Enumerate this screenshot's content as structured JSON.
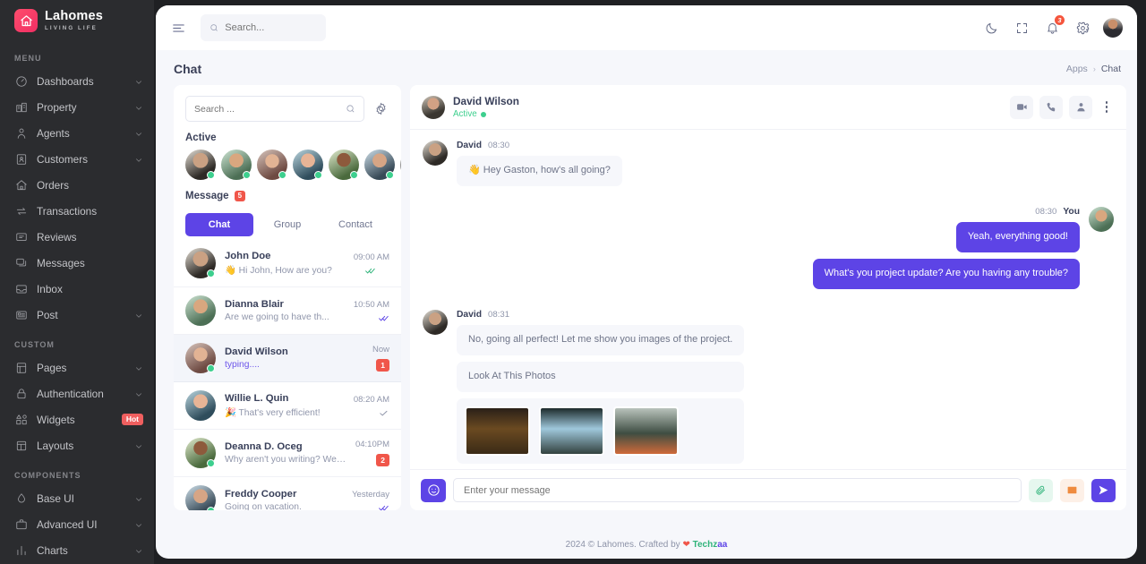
{
  "brand": {
    "name": "Lahomes",
    "tagline": "LIVING LIFE",
    "accent": "#5d44e6",
    "logo_color": "#f02e63"
  },
  "sidebar": {
    "sections": [
      {
        "label": "MENU",
        "items": [
          {
            "label": "Dashboards",
            "icon": "dashboard-icon",
            "chevron": true
          },
          {
            "label": "Property",
            "icon": "property-icon",
            "chevron": true
          },
          {
            "label": "Agents",
            "icon": "agents-icon",
            "chevron": true
          },
          {
            "label": "Customers",
            "icon": "customers-icon",
            "chevron": true
          },
          {
            "label": "Orders",
            "icon": "orders-icon",
            "chevron": false
          },
          {
            "label": "Transactions",
            "icon": "transactions-icon",
            "chevron": false
          },
          {
            "label": "Reviews",
            "icon": "reviews-icon",
            "chevron": false
          },
          {
            "label": "Messages",
            "icon": "messages-icon",
            "chevron": false
          },
          {
            "label": "Inbox",
            "icon": "inbox-icon",
            "chevron": false
          },
          {
            "label": "Post",
            "icon": "post-icon",
            "chevron": true
          }
        ]
      },
      {
        "label": "CUSTOM",
        "items": [
          {
            "label": "Pages",
            "icon": "pages-icon",
            "chevron": true
          },
          {
            "label": "Authentication",
            "icon": "lock-icon",
            "chevron": true
          },
          {
            "label": "Widgets",
            "icon": "widgets-icon",
            "chevron": false,
            "badge": "Hot"
          },
          {
            "label": "Layouts",
            "icon": "layouts-icon",
            "chevron": true
          }
        ]
      },
      {
        "label": "COMPONENTS",
        "items": [
          {
            "label": "Base UI",
            "icon": "baseui-icon",
            "chevron": true
          },
          {
            "label": "Advanced UI",
            "icon": "advancedui-icon",
            "chevron": true
          },
          {
            "label": "Charts",
            "icon": "charts-icon",
            "chevron": true
          }
        ]
      }
    ]
  },
  "topbar": {
    "search_placeholder": "Search...",
    "notification_count": "3"
  },
  "page": {
    "title": "Chat",
    "breadcrumb_root": "Apps",
    "breadcrumb_sep": "›",
    "breadcrumb_current": "Chat"
  },
  "chat_list": {
    "search_placeholder": "Search ...",
    "active_label": "Active",
    "active_count": 6,
    "message_label": "Message",
    "message_badge": "5",
    "tabs": [
      {
        "label": "Chat",
        "active": true
      },
      {
        "label": "Group",
        "active": false
      },
      {
        "label": "Contact",
        "active": false
      }
    ],
    "rows": [
      {
        "name": "John Doe",
        "preview": "👋 Hi John, How are you?",
        "time": "09:00 AM",
        "online": true,
        "status": "read-pin",
        "selected": false
      },
      {
        "name": "Dianna Blair",
        "preview": "Are we going to have th...",
        "time": "10:50 AM",
        "online": false,
        "status": "read",
        "selected": false
      },
      {
        "name": "David Wilson",
        "preview": "typing....",
        "time": "Now",
        "online": true,
        "status": "unread",
        "unread": "1",
        "selected": true,
        "typing": true
      },
      {
        "name": "Willie L. Quin",
        "preview": "🎉 That's very efficient!",
        "time": "08:20 AM",
        "online": false,
        "status": "sent",
        "selected": false
      },
      {
        "name": "Deanna D. Oceg",
        "preview": "Why aren't you writing? We don't...",
        "time": "04:10PM",
        "online": true,
        "status": "unread",
        "unread": "2",
        "selected": false
      },
      {
        "name": "Freddy Cooper",
        "preview": "Going on vacation.",
        "time": "Yesterday",
        "online": true,
        "status": "read",
        "selected": false
      }
    ]
  },
  "conversation": {
    "contact_name": "David Wilson",
    "contact_status": "Active",
    "actions": [
      "video-call-icon",
      "phone-call-icon",
      "contact-info-icon",
      "more-options-icon"
    ],
    "messages": [
      {
        "side": "them",
        "who": "David",
        "time": "08:30",
        "bubbles": [
          {
            "type": "text",
            "text": "👋 Hey Gaston, how's all going?"
          }
        ]
      },
      {
        "side": "me",
        "who": "You",
        "time": "08:30",
        "bubbles": [
          {
            "type": "text",
            "text": "Yeah, everything good!"
          },
          {
            "type": "text",
            "text": "What's you project update? Are you having any trouble?"
          }
        ]
      },
      {
        "side": "them",
        "who": "David",
        "time": "08:31",
        "bubbles": [
          {
            "type": "text",
            "text": "No, going all perfect! Let me show you images of the project."
          },
          {
            "type": "text",
            "text": "Look At This Photos"
          },
          {
            "type": "photos",
            "count": 3,
            "captions": [
              "storefront-night-photo",
              "mountain-cave-photo",
              "woman-laptop-photo"
            ]
          }
        ]
      }
    ],
    "composer": {
      "placeholder": "Enter your message",
      "emoji_button": "emoji-icon",
      "attach_button": "attachment-icon",
      "image_button": "image-icon",
      "send_button": "send-icon"
    }
  },
  "footer": {
    "prefix": "2024 © Lahomes. Crafted by",
    "heart": "❤",
    "brand_green": "Techz",
    "brand_purple": "aa"
  }
}
